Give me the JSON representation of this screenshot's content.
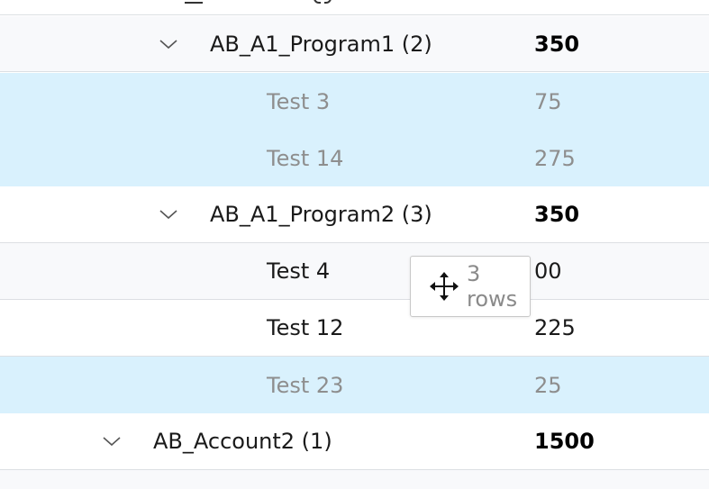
{
  "colors": {
    "selected_row_bg": "#d9f1fd",
    "alt_row_bg": "#f8f9fb",
    "row_border": "#dcdfe3",
    "dimmed_text": "#8e8e8e"
  },
  "rows": [
    {
      "label": "AB_A1_Program1 (2)",
      "value": "350",
      "type": "group",
      "expanded": true
    },
    {
      "label": "Test 3",
      "value": "75",
      "type": "item",
      "selected": true
    },
    {
      "label": "Test 14",
      "value": "275",
      "type": "item",
      "selected": true
    },
    {
      "label": "AB_A1_Program2 (3)",
      "value": "350",
      "type": "group",
      "expanded": true
    },
    {
      "label": "Test 4",
      "value": "00",
      "type": "item",
      "selected": false
    },
    {
      "label": "Test 12",
      "value": "225",
      "type": "item",
      "selected": false
    },
    {
      "label": "Test 23",
      "value": "25",
      "type": "item",
      "selected": true
    },
    {
      "label": "AB_Account2 (1)",
      "value": "1500",
      "type": "group",
      "expanded": true
    }
  ],
  "drag_tooltip": {
    "icon": "move-icon",
    "text": "3 rows"
  }
}
